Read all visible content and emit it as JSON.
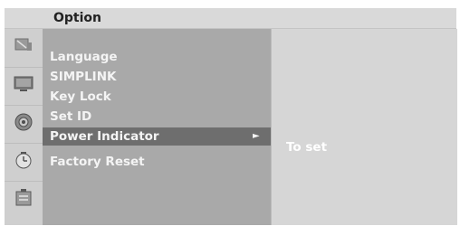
{
  "header": {
    "title": "Option"
  },
  "sidebar": {
    "icons": [
      {
        "name": "satellite-icon"
      },
      {
        "name": "tv-icon"
      },
      {
        "name": "speaker-icon"
      },
      {
        "name": "clock-icon"
      },
      {
        "name": "option-icon"
      }
    ]
  },
  "menu": {
    "items": [
      {
        "label": "Language"
      },
      {
        "label": "SIMPLINK"
      },
      {
        "label": "Key Lock"
      },
      {
        "label": "Set ID"
      },
      {
        "label": "Power Indicator",
        "selected": true,
        "arrow": "►"
      },
      {
        "label": "Factory Reset"
      }
    ]
  },
  "detail": {
    "text": "To set"
  },
  "colors": {
    "header_bg": "#d9d9d9",
    "menu_bg": "#a9a9a9",
    "selected_bg": "#6e6e6e",
    "right_bg": "#d6d6d6",
    "text_light": "#f4f4f4"
  }
}
